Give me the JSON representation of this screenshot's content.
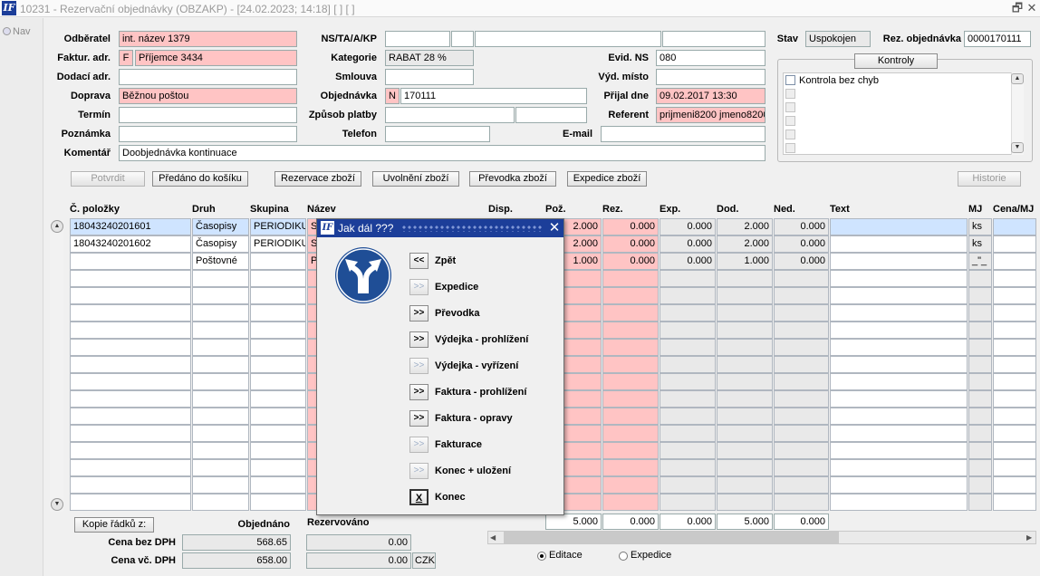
{
  "window": {
    "title": "10231 - Rezervační objednávky (OBZAKP) - [24.02.2023; 14:18] [ ] [ ]",
    "logo_text": "IF",
    "restore_glyph": "🗗",
    "close_glyph": "✕"
  },
  "nav": {
    "label": "Nav"
  },
  "form": {
    "odberatel": {
      "label": "Odběratel",
      "value": "int. název 1379"
    },
    "faktur_adr": {
      "label": "Faktur. adr.",
      "prefix": "F",
      "value": "Příjemce 3434"
    },
    "dodaci_adr": {
      "label": "Dodací adr.",
      "value": ""
    },
    "doprava": {
      "label": "Doprava",
      "value": "Běžnou poštou"
    },
    "termin": {
      "label": "Termín",
      "value": ""
    },
    "poznamka": {
      "label": "Poznámka",
      "value": ""
    },
    "komentar": {
      "label": "Komentář",
      "value": "Doobjednávka kontinuace"
    },
    "ns": {
      "label": "NS/TA/A/KP",
      "v1": "",
      "v2": "",
      "v3": "",
      "v4": ""
    },
    "kategorie": {
      "label": "Kategorie",
      "value": "RABAT 28 %"
    },
    "smlouva": {
      "label": "Smlouva",
      "value": ""
    },
    "objednavka": {
      "label": "Objednávka",
      "prefix": "N",
      "value": "170111"
    },
    "zpusob_platby": {
      "label": "Způsob platby",
      "v1": "",
      "v2": ""
    },
    "telefon": {
      "label": "Telefon",
      "value": ""
    },
    "evid_ns": {
      "label": "Evid. NS",
      "value": "080"
    },
    "vyd_misto": {
      "label": "Výd. místo",
      "value": ""
    },
    "prijal_dne": {
      "label": "Přijal dne",
      "value": "09.02.2017 13:30"
    },
    "referent": {
      "label": "Referent",
      "value": "prijmeni8200 jmeno8200"
    },
    "email": {
      "label": "E-mail",
      "value": ""
    },
    "stav": {
      "label": "Stav",
      "value": "Uspokojen"
    },
    "rez_obj": {
      "label": "Rez. objednávka",
      "value": "0000170111"
    }
  },
  "kontroly": {
    "title": "Kontroly",
    "items": [
      "Kontrola bez chyb"
    ],
    "up": "▲",
    "down": "▼"
  },
  "toolbar": {
    "potvrdit": "Potvrdit",
    "predano": "Předáno do košíku",
    "rezervace": "Rezervace zboží",
    "uvolneni": "Uvolnění zboží",
    "prevodka": "Převodka zboží",
    "expedice": "Expedice zboží",
    "historie": "Historie"
  },
  "grid": {
    "columns": {
      "polozka": "Č. položky",
      "druh": "Druh",
      "skupina": "Skupina",
      "nazev": "Název",
      "disp": "Disp.",
      "poz": "Pož.",
      "rez": "Rez.",
      "exp": "Exp.",
      "dod": "Dod.",
      "ned": "Ned.",
      "text": "Text",
      "mj": "MJ",
      "cena": "Cena/MJ"
    },
    "rows": [
      {
        "polozka": "18043240201601",
        "druh": "Časopisy",
        "skupina": "PERIODIKUM",
        "nazev": "S",
        "poz": "2.000",
        "rez": "0.000",
        "exp": "0.000",
        "dod": "2.000",
        "ned": "0.000",
        "mj": "ks"
      },
      {
        "polozka": "18043240201602",
        "druh": "Časopisy",
        "skupina": "PERIODIKUM",
        "nazev": "S",
        "poz": "2.000",
        "rez": "0.000",
        "exp": "0.000",
        "dod": "2.000",
        "ned": "0.000",
        "mj": "ks"
      },
      {
        "polozka": "",
        "druh": "Poštovné",
        "skupina": "",
        "nazev": "Po",
        "poz": "1.000",
        "rez": "0.000",
        "exp": "0.000",
        "dod": "1.000",
        "ned": "0.000",
        "mj": "_\"_"
      }
    ],
    "totals": {
      "poz": "5.000",
      "rez": "0.000",
      "exp": "0.000",
      "dod": "5.000",
      "ned": "0.000"
    },
    "scroll_up": "▲",
    "scroll_down": "▼",
    "hscroll_left": "◀",
    "hscroll_right": "▶"
  },
  "summary": {
    "kopie": "Kopie řádků z:",
    "objednano": "Objednáno",
    "rezervovano": "Rezervováno",
    "cena_bez": {
      "label": "Cena bez DPH",
      "objednano": "568.65",
      "rezervovano": "0.00"
    },
    "cena_vc": {
      "label": "Cena vč. DPH",
      "objednano": "658.00",
      "rezervovano": "0.00",
      "currency": "CZK"
    }
  },
  "mode": {
    "editace": "Editace",
    "expedice": "Expedice",
    "selected": "editace"
  },
  "dialog": {
    "title": "Jak dál ???",
    "close": "✕",
    "actions": [
      {
        "glyph": "<<",
        "label": "Zpět",
        "enabled": true
      },
      {
        "glyph": ">>",
        "label": "Expedice",
        "enabled": false
      },
      {
        "glyph": ">>",
        "label": "Převodka",
        "enabled": true
      },
      {
        "glyph": ">>",
        "label": "Výdejka - prohlížení",
        "enabled": true
      },
      {
        "glyph": ">>",
        "label": "Výdejka - vyřízení",
        "enabled": false
      },
      {
        "glyph": ">>",
        "label": "Faktura - prohlížení",
        "enabled": true
      },
      {
        "glyph": ">>",
        "label": "Faktura - opravy",
        "enabled": true
      },
      {
        "glyph": ">>",
        "label": "Fakturace",
        "enabled": false
      },
      {
        "glyph": ">>",
        "label": "Konec + uložení",
        "enabled": false
      },
      {
        "glyph": "X",
        "label": "Konec",
        "enabled": true
      }
    ],
    "colors": {
      "title_bg": "#1c3e99",
      "sign": "#1f4e96"
    }
  }
}
